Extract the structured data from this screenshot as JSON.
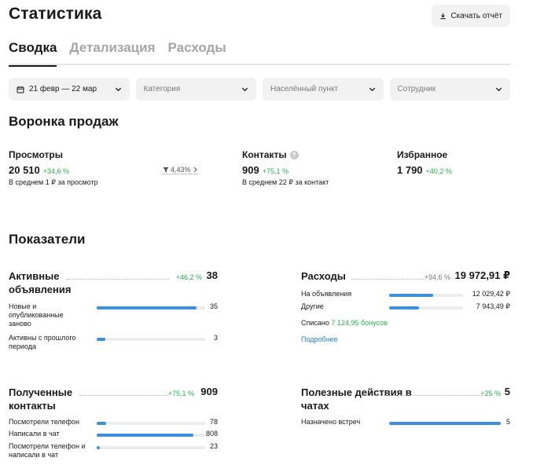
{
  "header": {
    "title": "Статистика",
    "download_label": "Скачать отчёт"
  },
  "tabs": [
    {
      "label": "Сводка",
      "active": true
    },
    {
      "label": "Детализация",
      "active": false
    },
    {
      "label": "Расходы",
      "active": false
    }
  ],
  "filters": {
    "date": "21 февр — 22 мар",
    "category": "Категория",
    "city": "Населённый пункт",
    "employee": "Сотрудник"
  },
  "funnel": {
    "title": "Воронка продаж",
    "views": {
      "label": "Просмотры",
      "value": "20 510",
      "delta": "+34,6 %",
      "sub": "В среднем 1 ₽ за просмотр"
    },
    "conversion": "4,43%",
    "contacts": {
      "label": "Контакты",
      "value": "909",
      "delta": "+75,1 %",
      "sub": "В среднем 22 ₽ за контакт"
    },
    "favorites": {
      "label": "Избранное",
      "value": "1 790",
      "delta": "+40,2 %"
    }
  },
  "indicators": {
    "title": "Показатели",
    "active_ads": {
      "title": "Активные объявления",
      "delta": "+46,2 %",
      "total": "38",
      "rows": [
        {
          "label": "Новые и опубликованные заново",
          "value": "35",
          "fraction": 0.92
        },
        {
          "label": "Активны с прошлого периода",
          "value": "3",
          "fraction": 0.08
        }
      ]
    },
    "expenses": {
      "title": "Расходы",
      "delta": "+94,6 %",
      "total": "19 972,91 ₽",
      "rows": [
        {
          "label": "На объявления",
          "value": "12 029,42 ₽",
          "fraction": 0.6
        },
        {
          "label": "Другие",
          "value": "7 943,49 ₽",
          "fraction": 0.4
        }
      ],
      "written_off_label": "Списано",
      "written_off_value": "7 124,95 бонусов",
      "more_link": "Подробнее"
    },
    "contacts": {
      "title": "Полученные контакты",
      "delta": "+75,1 %",
      "total": "909",
      "rows": [
        {
          "label": "Посмотрели телефон",
          "value": "78",
          "fraction": 0.09
        },
        {
          "label": "Написали в чат",
          "value": "808",
          "fraction": 0.89
        },
        {
          "label": "Посмотрели телефон и написали в чат",
          "value": "23",
          "fraction": 0.03
        }
      ]
    },
    "chat_actions": {
      "title": "Полезные действия в чатах",
      "delta": "+25 %",
      "total": "5",
      "rows": [
        {
          "label": "Назначено встреч",
          "value": "5",
          "fraction": 1.0
        }
      ]
    }
  },
  "colors": {
    "accent": "#3d8fdb",
    "positive": "#2bb24c",
    "track": "#ececec"
  }
}
